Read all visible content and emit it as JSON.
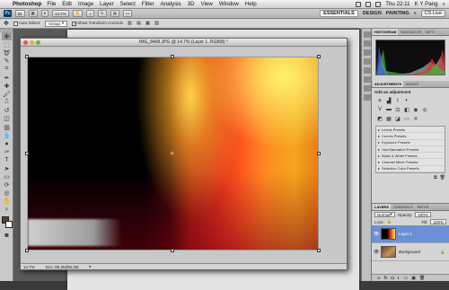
{
  "menubar": {
    "apple": "",
    "app_name": "Photoshop",
    "items": [
      "File",
      "Edit",
      "Image",
      "Layer",
      "Select",
      "Filter",
      "Analysis",
      "3D",
      "View",
      "Window",
      "Help"
    ],
    "clock": "Thu 22:11",
    "user": "K Y Pang"
  },
  "appbar": {
    "ps_badge": "Ps",
    "zoom": "14.7%",
    "workspaces": [
      "ESSENTIALS",
      "DESIGN",
      "PAINTING"
    ],
    "more": "»",
    "cs_live": "CS Live"
  },
  "options": {
    "auto_select_label": "Auto-Select:",
    "auto_select_value": "Group",
    "show_transform_label": "Show Transform Controls"
  },
  "document": {
    "title": "IMG_8409.JPG @ 14.7% (Layer 1, RGB/8) *",
    "zoom": "14.7%",
    "doc_info": "Doc: 65.2M/95.2M"
  },
  "panels": {
    "top_tabs": [
      "HISTOGRAM",
      "NAVIGATOR",
      "INFO"
    ],
    "adj_tabs": [
      "ADJUSTMENTS",
      "MASKS"
    ],
    "add_adjustment": "Add an adjustment",
    "presets": [
      "Levels Presets",
      "Curves Presets",
      "Exposure Presets",
      "Hue/Saturation Presets",
      "Black & White Presets",
      "Channel Mixer Presets",
      "Selective Color Presets"
    ],
    "layer_tabs": [
      "LAYERS",
      "CHANNELS",
      "PATHS"
    ],
    "blend_mode": "Normal",
    "opacity_label": "Opacity:",
    "opacity": "100%",
    "lock_label": "Lock:",
    "fill_label": "Fill:",
    "fill": "100%",
    "layers": [
      {
        "name": "Layer 1",
        "selected": true
      },
      {
        "name": "Background",
        "selected": false
      }
    ]
  },
  "colors": {
    "selected_layer": "#6d8fd8",
    "canvas_orange": "#ff8a22",
    "canvas_yellow": "#fff26a"
  }
}
